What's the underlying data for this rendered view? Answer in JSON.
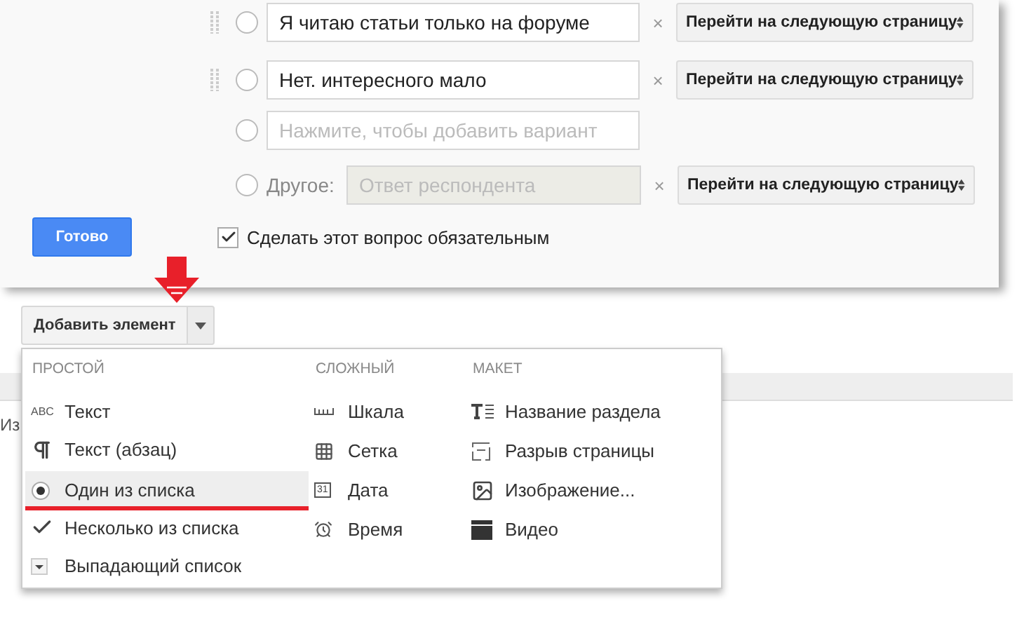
{
  "options": [
    {
      "kind": "answer",
      "draggable": true,
      "checked": false,
      "value": "Я читаю статьи только на форуме",
      "remove": "×",
      "navigation": "Перейти на следующую страницу"
    },
    {
      "kind": "answer",
      "draggable": true,
      "checked": false,
      "value": "Нет. интересного мало",
      "remove": "×",
      "navigation": "Перейти на следующую страницу"
    },
    {
      "kind": "add",
      "draggable": false,
      "checked": false,
      "placeholder": "Нажмите, чтобы добавить вариант"
    },
    {
      "kind": "other",
      "draggable": false,
      "checked": false,
      "label": "Другое:",
      "placeholder": "Ответ респондента",
      "remove": "×",
      "navigation": "Перейти на следующую страницу"
    }
  ],
  "done_button": "Готово",
  "required": {
    "label": "Сделать этот вопрос обязательным",
    "checked": true
  },
  "add_item": {
    "label": "Добавить элемент"
  },
  "background_text": "Из",
  "menu": {
    "columns": [
      {
        "header": "ПРОСТОЙ",
        "items": [
          {
            "kind": "abc",
            "badge": "ABC",
            "label": "Текст",
            "selected": false
          },
          {
            "kind": "paragraph",
            "label": "Текст (абзац)",
            "selected": false
          },
          {
            "kind": "radio",
            "label": "Один из списка",
            "selected": true
          },
          {
            "kind": "check",
            "label": "Несколько из списка",
            "selected": false
          },
          {
            "kind": "dropdown",
            "label": "Выпадающий список",
            "selected": false
          }
        ]
      },
      {
        "header": "СЛОЖНЫЙ",
        "items": [
          {
            "kind": "scale",
            "label": "Шкала",
            "selected": false
          },
          {
            "kind": "grid",
            "label": "Сетка",
            "selected": false
          },
          {
            "kind": "date",
            "badge": "31",
            "label": "Дата",
            "selected": false
          },
          {
            "kind": "time",
            "label": "Время",
            "selected": false
          }
        ]
      },
      {
        "header": "МАКЕТ",
        "items": [
          {
            "kind": "section",
            "label": "Название раздела",
            "selected": false
          },
          {
            "kind": "pagebreak",
            "label": "Разрыв страницы",
            "selected": false
          },
          {
            "kind": "image",
            "label": "Изображение...",
            "selected": false
          },
          {
            "kind": "video",
            "label": "Видео",
            "selected": false
          }
        ]
      }
    ]
  }
}
